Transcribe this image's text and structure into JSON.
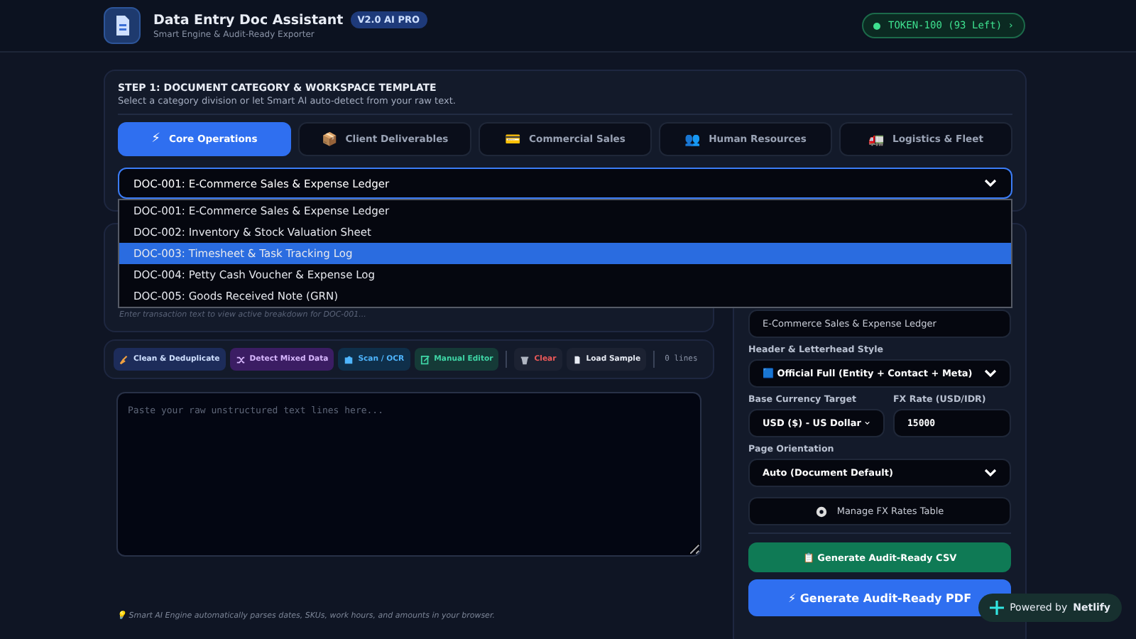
{
  "header": {
    "title": "Data Entry Doc Assistant",
    "version_badge": "V2.0 AI PRO",
    "subtitle": "Smart Engine & Audit-Ready Exporter",
    "token": "TOKEN-100 (93 Left)",
    "token_arrow": "›"
  },
  "step1": {
    "title": "STEP 1: DOCUMENT CATEGORY & WORKSPACE TEMPLATE",
    "subtitle": "Select a category division or let Smart AI auto-detect from your raw text.",
    "tabs": [
      {
        "icon": "⚡",
        "label": "Core Operations",
        "selected": true
      },
      {
        "icon": "📦",
        "label": "Client Deliverables",
        "selected": false
      },
      {
        "icon": "💳",
        "label": "Commercial Sales",
        "selected": false
      },
      {
        "icon": "👥",
        "label": "Human Resources",
        "selected": false
      },
      {
        "icon": "🚛",
        "label": "Logistics & Fleet",
        "selected": false
      }
    ],
    "template_select": {
      "value": "DOC-001: E-Commerce Sales & Expense Ledger",
      "expanded": true,
      "options": [
        {
          "label": "DOC-001: E-Commerce Sales & Expense Ledger",
          "highlighted": false
        },
        {
          "label": "DOC-002: Inventory & Stock Valuation Sheet",
          "highlighted": false
        },
        {
          "label": "DOC-003: Timesheet & Task Tracking Log",
          "highlighted": true
        },
        {
          "label": "DOC-004: Petty Cash Voucher & Expense Log",
          "highlighted": false
        },
        {
          "label": "DOC-005: Goods Received Note (GRN)",
          "highlighted": false
        }
      ]
    }
  },
  "breakdown_hint": "Enter transaction text to view active breakdown for DOC-001...",
  "toolbar": [
    {
      "kind": "clean",
      "label": "Clean & Deduplicate"
    },
    {
      "kind": "detect",
      "label": "Detect Mixed Data"
    },
    {
      "kind": "scan",
      "label": "Scan / OCR"
    },
    {
      "kind": "manual",
      "label": "Manual Editor"
    },
    {
      "kind": "separator"
    },
    {
      "kind": "clear",
      "label": "Clear"
    },
    {
      "kind": "sample",
      "label": "Load Sample"
    },
    {
      "kind": "separator"
    },
    {
      "kind": "count",
      "label": "0 lines"
    }
  ],
  "raw_text": {
    "placeholder": "Paste your raw unstructured text lines here..."
  },
  "footer_hint": "💡 Smart AI Engine automatically parses dates, SKUs, work hours, and amounts in your browser.",
  "settings": {
    "doc_title_value": "E-Commerce Sales & Expense Ledger",
    "header_style": {
      "label": "Header & Letterhead Style",
      "value": "🟦 Official Full (Entity + Contact + Meta)"
    },
    "currency": {
      "label": "Base Currency Target",
      "value": "USD ($) - US Dollar"
    },
    "fx_rate": {
      "label": "FX Rate (USD/IDR)",
      "value": "15000"
    },
    "orientation": {
      "label": "Page Orientation",
      "value": "Auto (Document Default)"
    },
    "fx_button": "Manage FX Rates Table",
    "csv_icon": "📋",
    "csv_button": "Generate Audit-Ready CSV",
    "pdf_icon": "⚡",
    "pdf_button": "Generate Audit-Ready PDF"
  },
  "netlify_badge": {
    "prefix": "Powered by",
    "brand": "Netlify"
  }
}
